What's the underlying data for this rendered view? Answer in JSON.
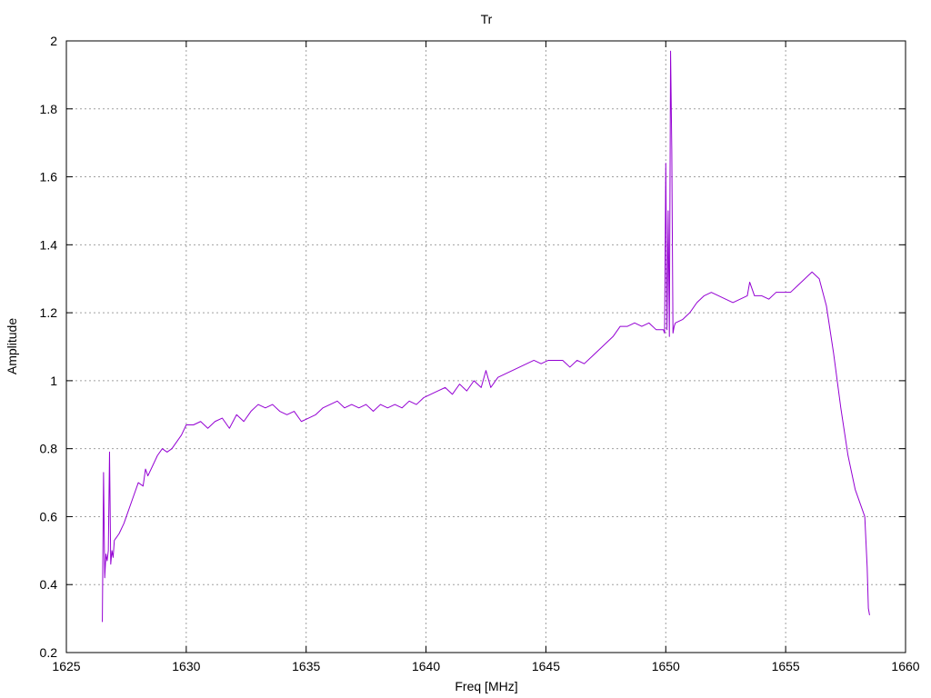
{
  "chart_data": {
    "type": "line",
    "title": "Tr",
    "xlabel": "Freq [MHz]",
    "ylabel": "Amplitude",
    "xlim": [
      1625,
      1660
    ],
    "ylim": [
      0.2,
      2
    ],
    "xticks": [
      1625,
      1630,
      1635,
      1640,
      1645,
      1650,
      1655,
      1660
    ],
    "yticks": [
      0.2,
      0.4,
      0.6,
      0.8,
      1,
      1.2,
      1.4,
      1.6,
      1.8,
      2
    ],
    "xtick_labels": [
      "1625",
      "1630",
      "1635",
      "1640",
      "1645",
      "1650",
      "1655",
      "1660"
    ],
    "ytick_labels": [
      "0.2",
      "0.4",
      "0.6",
      "0.8",
      "1",
      "1.2",
      "1.4",
      "1.6",
      "1.8",
      "2"
    ],
    "grid": true,
    "line_color": "#9400D3",
    "series": [
      {
        "x": [
          1626.5,
          1626.55,
          1626.6,
          1626.65,
          1626.7,
          1626.75,
          1626.8,
          1626.85,
          1626.9,
          1626.95,
          1627.0,
          1627.2,
          1627.4,
          1627.6,
          1627.8,
          1628.0,
          1628.2,
          1628.3,
          1628.4,
          1628.6,
          1628.8,
          1629.0,
          1629.2,
          1629.4,
          1629.6,
          1629.8,
          1630.0,
          1630.3,
          1630.6,
          1630.9,
          1631.2,
          1631.5,
          1631.8,
          1632.1,
          1632.4,
          1632.7,
          1633.0,
          1633.3,
          1633.6,
          1633.9,
          1634.2,
          1634.5,
          1634.8,
          1635.1,
          1635.4,
          1635.7,
          1636.0,
          1636.3,
          1636.6,
          1636.9,
          1637.2,
          1637.5,
          1637.8,
          1638.1,
          1638.4,
          1638.7,
          1639.0,
          1639.3,
          1639.6,
          1639.9,
          1640.2,
          1640.5,
          1640.8,
          1641.1,
          1641.4,
          1641.7,
          1642.0,
          1642.3,
          1642.5,
          1642.7,
          1643.0,
          1643.3,
          1643.6,
          1643.9,
          1644.2,
          1644.5,
          1644.8,
          1645.1,
          1645.4,
          1645.7,
          1646.0,
          1646.3,
          1646.6,
          1646.9,
          1647.2,
          1647.5,
          1647.8,
          1648.1,
          1648.4,
          1648.7,
          1649.0,
          1649.3,
          1649.6,
          1649.9,
          1649.95,
          1650.0,
          1650.05,
          1650.1,
          1650.15,
          1650.2,
          1650.25,
          1650.3,
          1650.35,
          1650.4,
          1650.7,
          1651.0,
          1651.3,
          1651.6,
          1651.9,
          1652.2,
          1652.5,
          1652.8,
          1653.1,
          1653.4,
          1653.5,
          1653.7,
          1654.0,
          1654.3,
          1654.6,
          1654.9,
          1655.2,
          1655.5,
          1655.8,
          1656.1,
          1656.4,
          1656.7,
          1657.0,
          1657.3,
          1657.6,
          1657.9,
          1658.2,
          1658.3,
          1658.4,
          1658.45,
          1658.5
        ],
        "y": [
          0.29,
          0.73,
          0.42,
          0.49,
          0.47,
          0.5,
          0.79,
          0.46,
          0.5,
          0.48,
          0.53,
          0.55,
          0.58,
          0.62,
          0.66,
          0.7,
          0.69,
          0.74,
          0.72,
          0.75,
          0.78,
          0.8,
          0.79,
          0.8,
          0.82,
          0.84,
          0.87,
          0.87,
          0.88,
          0.86,
          0.88,
          0.89,
          0.86,
          0.9,
          0.88,
          0.91,
          0.93,
          0.92,
          0.93,
          0.91,
          0.9,
          0.91,
          0.88,
          0.89,
          0.9,
          0.92,
          0.93,
          0.94,
          0.92,
          0.93,
          0.92,
          0.93,
          0.91,
          0.93,
          0.92,
          0.93,
          0.92,
          0.94,
          0.93,
          0.95,
          0.96,
          0.97,
          0.98,
          0.96,
          0.99,
          0.97,
          1.0,
          0.98,
          1.03,
          0.98,
          1.01,
          1.02,
          1.03,
          1.04,
          1.05,
          1.06,
          1.05,
          1.06,
          1.06,
          1.06,
          1.04,
          1.06,
          1.05,
          1.07,
          1.09,
          1.11,
          1.13,
          1.16,
          1.16,
          1.17,
          1.16,
          1.17,
          1.15,
          1.15,
          1.14,
          1.64,
          1.15,
          1.5,
          1.13,
          1.97,
          1.68,
          1.14,
          1.16,
          1.17,
          1.18,
          1.2,
          1.23,
          1.25,
          1.26,
          1.25,
          1.24,
          1.23,
          1.24,
          1.25,
          1.29,
          1.25,
          1.25,
          1.24,
          1.26,
          1.26,
          1.26,
          1.28,
          1.3,
          1.32,
          1.3,
          1.22,
          1.08,
          0.92,
          0.78,
          0.68,
          0.62,
          0.6,
          0.45,
          0.33,
          0.31
        ]
      }
    ]
  }
}
